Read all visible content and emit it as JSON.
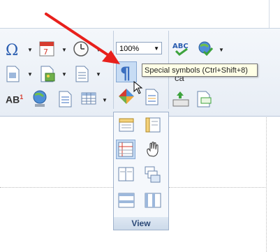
{
  "ribbon": {
    "zoom_value": "100%",
    "zoom_dropdown_arrow": "▼",
    "caps_label": "AB",
    "caps_superscript": "1",
    "case_text": "ca",
    "dropdown_glyph": "▼"
  },
  "tooltip": {
    "text": "Special symbols (Ctrl+Shift+8)"
  },
  "view_panel": {
    "label": "View"
  },
  "colors": {
    "arrow": "#e8201c",
    "accent": "#3b6fc0",
    "panel_label": "#2c4a78"
  },
  "icons": [
    "omega-icon",
    "calendar-icon",
    "clock-icon",
    "spellcheck-icon",
    "globe-check-icon",
    "document-icon",
    "image-document-icon",
    "page-list-icon",
    "pilcrow-icon",
    "shapes-icon",
    "document-lines-icon",
    "globe-network-icon",
    "table-icon",
    "keyboard-icon",
    "ruler-horizontal-icon",
    "ruler-vertical-icon",
    "grid-lines-icon",
    "hand-icon",
    "two-pages-icon",
    "stacked-windows-icon",
    "horizontal-split-icon",
    "vertical-split-icon",
    "cursor-icon"
  ]
}
